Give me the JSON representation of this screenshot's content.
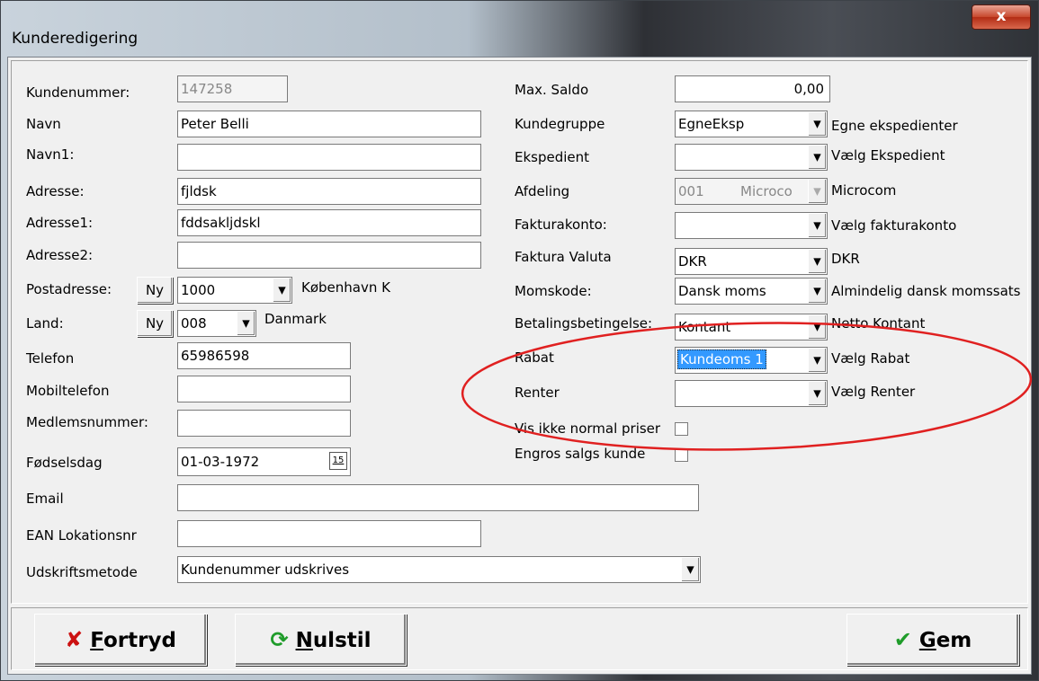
{
  "window": {
    "title": "Kunderedigering",
    "close_glyph": "x"
  },
  "left": {
    "kundenummer": {
      "label": "Kundenummer:",
      "value": "147258"
    },
    "navn": {
      "label": "Navn",
      "value": "Peter Belli"
    },
    "navn1": {
      "label": "Navn1:",
      "value": ""
    },
    "adresse": {
      "label": "Adresse:",
      "value": "fjldsk"
    },
    "adresse1": {
      "label": "Adresse1:",
      "value": "fddsakljdskl"
    },
    "adresse2": {
      "label": "Adresse2:",
      "value": ""
    },
    "postadresse": {
      "label": "Postadresse:",
      "ny_label": "Ny",
      "value": "1000",
      "city": "København K"
    },
    "land": {
      "label": "Land:",
      "ny_label": "Ny",
      "value": "008",
      "country": "Danmark"
    },
    "telefon": {
      "label": "Telefon",
      "value": "65986598"
    },
    "mobiltelefon": {
      "label": "Mobiltelefon",
      "value": ""
    },
    "medlemsnummer": {
      "label": "Medlemsnummer:",
      "value": ""
    },
    "foedselsdag": {
      "label": "Fødselsdag",
      "value": "01-03-1972",
      "cal_glyph": "15"
    },
    "email": {
      "label": "Email",
      "value": ""
    },
    "ean": {
      "label": "EAN Lokationsnr",
      "value": ""
    },
    "udskriftsmetode": {
      "label": "Udskriftsmetode",
      "value": "Kundenummer udskrives"
    }
  },
  "right": {
    "max_saldo": {
      "label": "Max. Saldo",
      "value": "0,00"
    },
    "kundegruppe": {
      "label": "Kundegruppe",
      "value": "EgneEksp",
      "desc": "Egne ekspedienter"
    },
    "ekspedient": {
      "label": "Ekspedient",
      "value": "",
      "desc": "Vælg Ekspedient"
    },
    "afdeling": {
      "label": "Afdeling",
      "value": "001",
      "sub": "Microco",
      "desc": "Microcom"
    },
    "fakturakonto": {
      "label": "Fakturakonto:",
      "value": "",
      "desc": "Vælg fakturakonto"
    },
    "faktura_valuta": {
      "label": "Faktura Valuta",
      "value": "DKR",
      "desc": "DKR"
    },
    "momskode": {
      "label": "Momskode:",
      "value": "Dansk moms",
      "desc": "Almindelig dansk momssats"
    },
    "betaling": {
      "label": "Betalingsbetingelse:",
      "value": "Kontant",
      "desc": "Netto Kontant"
    },
    "rabat": {
      "label": "Rabat",
      "value": "Kundeoms 1",
      "desc": "Vælg Rabat"
    },
    "renter": {
      "label": "Renter",
      "value": "",
      "desc": "Vælg Renter"
    },
    "vis_ikke": {
      "label": "Vis ikke normal priser",
      "checked": false
    },
    "engros": {
      "label": "Engros salgs kunde",
      "checked": false
    }
  },
  "buttons": {
    "fortryd": {
      "icon": "✘",
      "first": "F",
      "rest": "ortryd"
    },
    "nulstil": {
      "icon": "⟳",
      "first": "N",
      "rest": "ulstil"
    },
    "gem": {
      "icon": "✔",
      "first": "G",
      "rest": "em"
    }
  },
  "colors": {
    "annotation_ellipse": "#e02020",
    "selection": "#3399ff",
    "fortryd_icon": "#cc1111",
    "nulstil_icon": "#1f9c2a",
    "gem_icon": "#1f9c2a"
  }
}
